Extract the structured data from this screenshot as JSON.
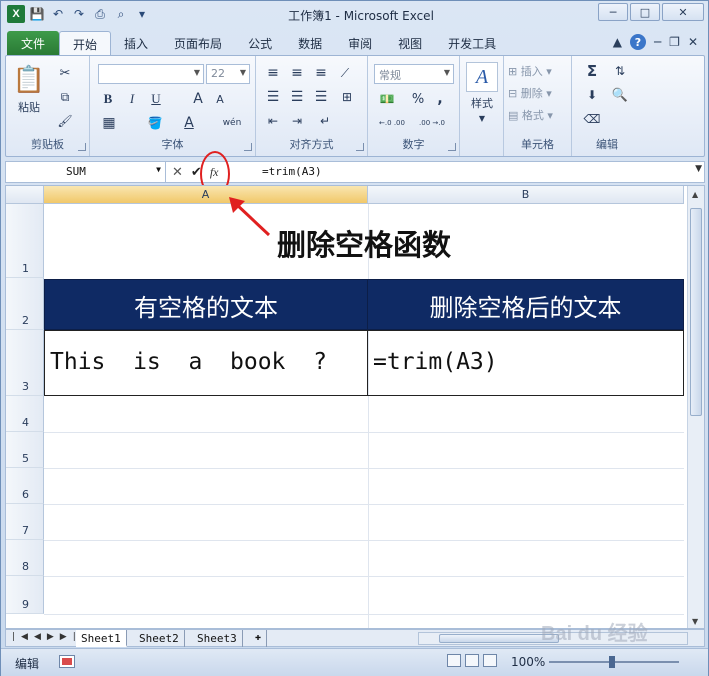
{
  "window": {
    "title": "工作簿1 - Microsoft Excel",
    "excel_logo_letter": "X"
  },
  "ribbon": {
    "tabs": [
      "文件",
      "开始",
      "插入",
      "页面布局",
      "公式",
      "数据",
      "审阅",
      "视图",
      "开发工具"
    ],
    "active_tab": "开始",
    "clipboard": {
      "paste_label": "粘贴",
      "group_label": "剪贴板"
    },
    "font": {
      "font_name": "",
      "font_size": "22",
      "group_label": "字体",
      "bold": "B",
      "italic": "I",
      "underline": "U",
      "grow": "A",
      "shrink": "A",
      "wen": "wén"
    },
    "alignment": {
      "group_label": "对齐方式"
    },
    "number": {
      "format": "常规",
      "percent": "%",
      "comma": ",",
      "group_label": "数字",
      "inc_decimal": "←.0 .00",
      "dec_decimal": ".00 →.0"
    },
    "styles": {
      "label": "样式"
    },
    "cells": {
      "insert": "插入",
      "delete": "删除",
      "format": "格式",
      "group_label": "单元格"
    },
    "editing": {
      "sum": "Σ",
      "group_label": "编辑"
    }
  },
  "formula_bar": {
    "name_box": "SUM",
    "cancel": "✕",
    "enter": "✔",
    "fx": "fx",
    "formula": "=trim(A3)"
  },
  "sheet": {
    "columns": [
      "A",
      "B"
    ],
    "rows": [
      "1",
      "2",
      "3",
      "4",
      "5",
      "6",
      "7",
      "8",
      "9"
    ],
    "title": "删除空格函数",
    "header_a": "有空格的文本",
    "header_b": "删除空格后的文本",
    "a3": "This  is  a  book  ?",
    "b3": "=trim(A3)",
    "colors": {
      "header_bg": "#0f2a64",
      "header_text": "#ffffff"
    }
  },
  "sheet_tabs": [
    "Sheet1",
    "Sheet2",
    "Sheet3"
  ],
  "active_sheet": "Sheet1",
  "status_bar": {
    "mode": "编辑",
    "zoom": "100%"
  },
  "watermark": "Bai du 经验"
}
